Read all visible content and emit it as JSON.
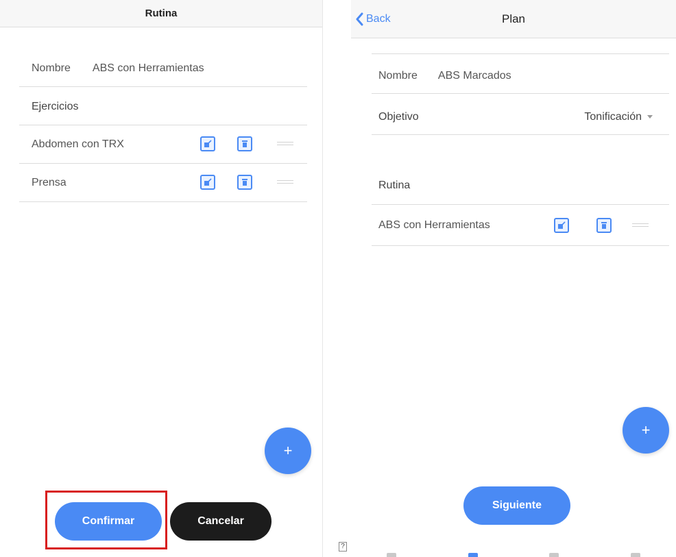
{
  "left": {
    "title": "Rutina",
    "nombre_label": "Nombre",
    "nombre_value": "ABS con Herramientas",
    "ejercicios_label": "Ejercicios",
    "exercises": [
      {
        "name": "Abdomen con TRX"
      },
      {
        "name": "Prensa"
      }
    ],
    "fab_label": "+",
    "confirm_label": "Confirmar",
    "cancel_label": "Cancelar"
  },
  "right": {
    "back_label": "Back",
    "title": "Plan",
    "nombre_label": "Nombre",
    "nombre_value": "ABS Marcados",
    "objetivo_label": "Objetivo",
    "objetivo_value": "Tonificación",
    "rutina_label": "Rutina",
    "routines": [
      {
        "name": "ABS con Herramientas"
      }
    ],
    "fab_label": "+",
    "next_label": "Siguiente"
  },
  "icons": {
    "edit": "edit-icon",
    "delete": "trash-icon",
    "drag": "drag-handle-icon",
    "back": "chevron-left-icon"
  },
  "colors": {
    "accent": "#4a8af4",
    "dark_button": "#1c1c1c",
    "highlight": "#d81e1e"
  }
}
